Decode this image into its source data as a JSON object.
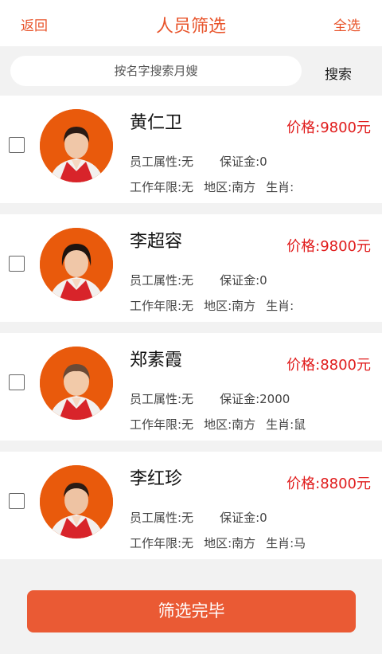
{
  "header": {
    "back_label": "返回",
    "title": "人员筛选",
    "select_all_label": "全选"
  },
  "search": {
    "placeholder": "按名字搜索月嫂",
    "value": "",
    "button_label": "搜索"
  },
  "staff": [
    {
      "name": "黄仁卫",
      "price": "价格:9800元",
      "attribute": "员工属性:无",
      "deposit": "保证金:0",
      "years": "工作年限:无",
      "region": "地区:南方",
      "zodiac": "生肖:"
    },
    {
      "name": "李超容",
      "price": "价格:9800元",
      "attribute": "员工属性:无",
      "deposit": "保证金:0",
      "years": "工作年限:无",
      "region": "地区:南方",
      "zodiac": "生肖:"
    },
    {
      "name": "郑素霞",
      "price": "价格:8800元",
      "attribute": "员工属性:无",
      "deposit": "保证金:2000",
      "years": "工作年限:无",
      "region": "地区:南方",
      "zodiac": "生肖:鼠"
    },
    {
      "name": "李红珍",
      "price": "价格:8800元",
      "attribute": "员工属性:无",
      "deposit": "保证金:0",
      "years": "工作年限:无",
      "region": "地区:南方",
      "zodiac": "生肖:马"
    }
  ],
  "footer": {
    "done_label": "筛选完毕"
  },
  "colors": {
    "accent": "#e8542b",
    "price": "#e01b1b",
    "avatar_bg": "#e95a0c"
  }
}
